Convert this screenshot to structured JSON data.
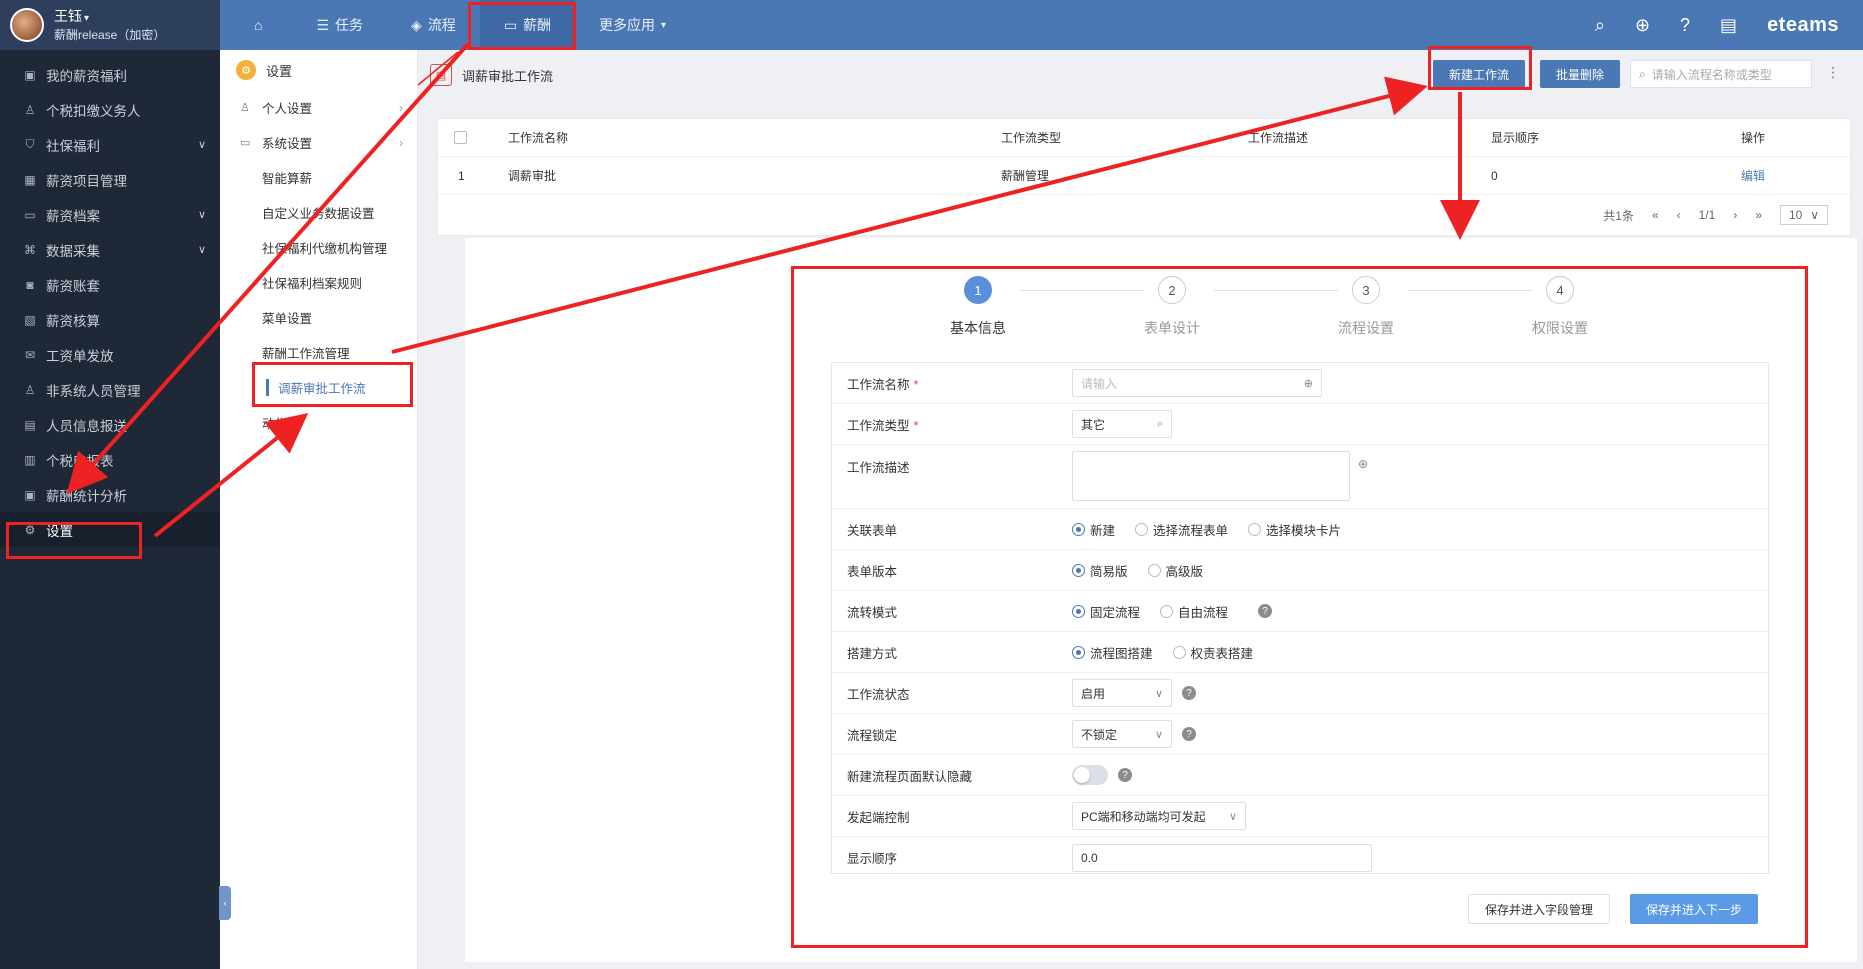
{
  "user": {
    "name": "王钰",
    "sub": "薪酬release（加密）"
  },
  "topnav": [
    {
      "label": "",
      "icon": "home-icon"
    },
    {
      "label": "任务",
      "icon": "list-icon"
    },
    {
      "label": "流程",
      "icon": "layers-icon"
    },
    {
      "label": "薪酬",
      "icon": "card-icon"
    },
    {
      "label": "更多应用",
      "icon": "chevron-down-icon"
    }
  ],
  "brand": "eteams",
  "sidebar": [
    {
      "label": "我的薪资福利"
    },
    {
      "label": "个税扣缴义务人"
    },
    {
      "label": "社保福利"
    },
    {
      "label": "薪资项目管理"
    },
    {
      "label": "薪资档案"
    },
    {
      "label": "数据采集"
    },
    {
      "label": "薪资账套"
    },
    {
      "label": "薪资核算"
    },
    {
      "label": "工资单发放"
    },
    {
      "label": "非系统人员管理"
    },
    {
      "label": "人员信息报送"
    },
    {
      "label": "个税申报表"
    },
    {
      "label": "薪酬统计分析"
    },
    {
      "label": "设置"
    }
  ],
  "subnav": {
    "head": "设置",
    "personal": "个人设置",
    "system": "系统设置",
    "items": [
      "智能算薪",
      "自定义业务数据设置",
      "社保福利代缴机构管理",
      "社保福利档案规则",
      "菜单设置",
      "薪酬工作流管理",
      "调薪审批工作流",
      "动作流"
    ]
  },
  "page": {
    "title": "调薪审批工作流",
    "new_btn": "新建工作流",
    "batch_delete": "批量删除",
    "search_placeholder": "请输入流程名称或类型"
  },
  "table": {
    "headers": [
      "工作流名称",
      "工作流类型",
      "工作流描述",
      "显示顺序",
      "操作"
    ],
    "rows": [
      {
        "index": "1",
        "name": "调薪审批",
        "type": "薪酬管理",
        "desc": "",
        "order": "0",
        "op": "编辑"
      }
    ],
    "pager": {
      "total": "共1条",
      "page": "1/1",
      "size": "10"
    }
  },
  "steps": [
    {
      "num": "1",
      "label": "基本信息"
    },
    {
      "num": "2",
      "label": "表单设计"
    },
    {
      "num": "3",
      "label": "流程设置"
    },
    {
      "num": "4",
      "label": "权限设置"
    }
  ],
  "form": {
    "name_label": "工作流名称",
    "name_placeholder": "请输入",
    "type_label": "工作流类型",
    "type_value": "其它",
    "desc_label": "工作流描述",
    "form_label": "关联表单",
    "form_options": [
      "新建",
      "选择流程表单",
      "选择模块卡片"
    ],
    "version_label": "表单版本",
    "version_options": [
      "简易版",
      "高级版"
    ],
    "flow_mode_label": "流转模式",
    "flow_mode_options": [
      "固定流程",
      "自由流程"
    ],
    "build_label": "搭建方式",
    "build_options": [
      "流程图搭建",
      "权责表搭建"
    ],
    "status_label": "工作流状态",
    "status_value": "启用",
    "lock_label": "流程锁定",
    "lock_value": "不锁定",
    "hide_label": "新建流程页面默认隐藏",
    "launch_label": "发起端控制",
    "launch_value": "PC端和移动端均可发起",
    "order_label": "显示顺序",
    "order_value": "0.0",
    "save_fields": "保存并进入字段管理",
    "save_next": "保存并进入下一步"
  }
}
